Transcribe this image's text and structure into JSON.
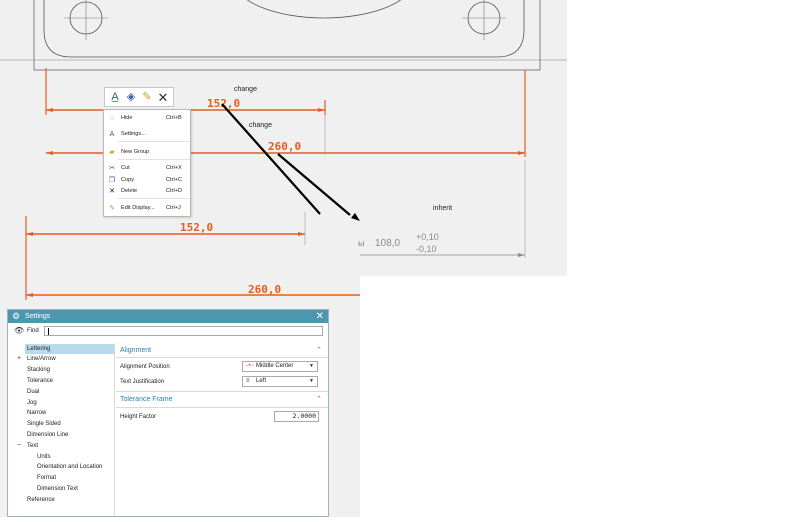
{
  "drawing": {
    "annotations": [
      "change",
      "change",
      "inherit"
    ],
    "dimensions": [
      "152,0",
      "260,0",
      "152,0",
      "260,0"
    ],
    "tolerance_dimension": {
      "value": "108,0",
      "upper": "+0,10",
      "lower": "-0,10"
    },
    "colors": {
      "dimension": "#e65c1e",
      "geometry": "#555555",
      "callout": "#000000"
    }
  },
  "mini_toolbar": {
    "icons": [
      "edit-lettering-icon",
      "edit-style-icon",
      "paint-icon",
      "close-icon"
    ]
  },
  "context_menu": {
    "items": [
      {
        "label": "Hide",
        "shortcut": "Ctrl+B",
        "icon": "hide-icon"
      },
      {
        "label": "Settings...",
        "shortcut": "",
        "icon": "settings-icon"
      },
      {
        "label": "New Group",
        "shortcut": "",
        "icon": "folder-icon"
      },
      {
        "label": "Cut",
        "shortcut": "Ctrl+X",
        "icon": "cut-icon"
      },
      {
        "label": "Copy",
        "shortcut": "Ctrl+C",
        "icon": "copy-icon"
      },
      {
        "label": "Delete",
        "shortcut": "Ctrl+D",
        "icon": "delete-icon"
      },
      {
        "label": "Edit Display...",
        "shortcut": "Ctrl+J",
        "icon": "edit-display-icon"
      }
    ]
  },
  "settings_dialog": {
    "title": "Settings",
    "find_label": "Find",
    "find_value": "",
    "tree": [
      {
        "label": "Lettering",
        "selected": true
      },
      {
        "label": "Line/Arrow",
        "expander": "+"
      },
      {
        "label": "Stacking"
      },
      {
        "label": "Tolerance"
      },
      {
        "label": "Dual"
      },
      {
        "label": "Jog"
      },
      {
        "label": "Narrow"
      },
      {
        "label": "Single Sided"
      },
      {
        "label": "Dimension Line"
      },
      {
        "label": "Text",
        "expander": "−"
      },
      {
        "label": "Units"
      },
      {
        "label": "Orientation and Location"
      },
      {
        "label": "Format"
      },
      {
        "label": "Dimension Text"
      },
      {
        "label": "Reference"
      }
    ],
    "sections": {
      "alignment": {
        "header": "Alignment",
        "alignment_position_label": "Alignment Position",
        "alignment_position_value": "Middle Center",
        "text_justification_label": "Text Justification",
        "text_justification_value": "Left"
      },
      "tolerance_frame": {
        "header": "Tolerance Frame",
        "height_factor_label": "Height Factor",
        "height_factor_value": "2.0000"
      }
    }
  }
}
